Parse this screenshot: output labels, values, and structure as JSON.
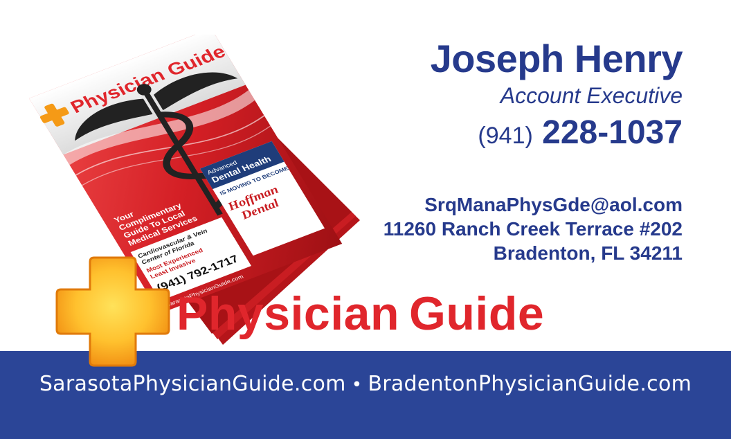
{
  "contact": {
    "name": "Joseph Henry",
    "title": "Account Executive",
    "phone_area": "(941)",
    "phone_number": "228-1037",
    "email": "SrqManaPhysGde@aol.com",
    "address_line1": "11260 Ranch Creek Terrace #202",
    "address_line2": "Bradenton, FL 34211"
  },
  "brand": {
    "word1": "Physician",
    "word2": "Guide"
  },
  "websites": {
    "site1": "SarasotaPhysicianGuide.com",
    "separator": "•",
    "site2": "BradentonPhysicianGuide.com"
  },
  "magazine_cover": {
    "title": "Physician Guide",
    "tagline": [
      "Your",
      "Complimentary",
      "Guide To Local",
      "Medical Services"
    ],
    "ad1_lines": [
      "Cardiovascular & Vein",
      "Center of Florida"
    ],
    "ad1_sub": [
      "Most Experienced",
      "Least Invasive"
    ],
    "ad1_phone": "(941) 792-1717",
    "ad2_brand": "Advanced",
    "ad2_title": "Dental Health",
    "ad2_sub": "IS MOVING TO BECOME",
    "ad2_name": [
      "Hoffman",
      "Dental"
    ],
    "url": "SarasotaPhysicianGuide.com"
  },
  "colors": {
    "navy": "#263a8c",
    "band": "#2b4597",
    "red": "#e0262c",
    "cross_orange": "#f59a16",
    "cross_yellow": "#ffd23a"
  },
  "icons": {
    "logo": "orange-cross-icon",
    "emblem": "caduceus-icon"
  }
}
